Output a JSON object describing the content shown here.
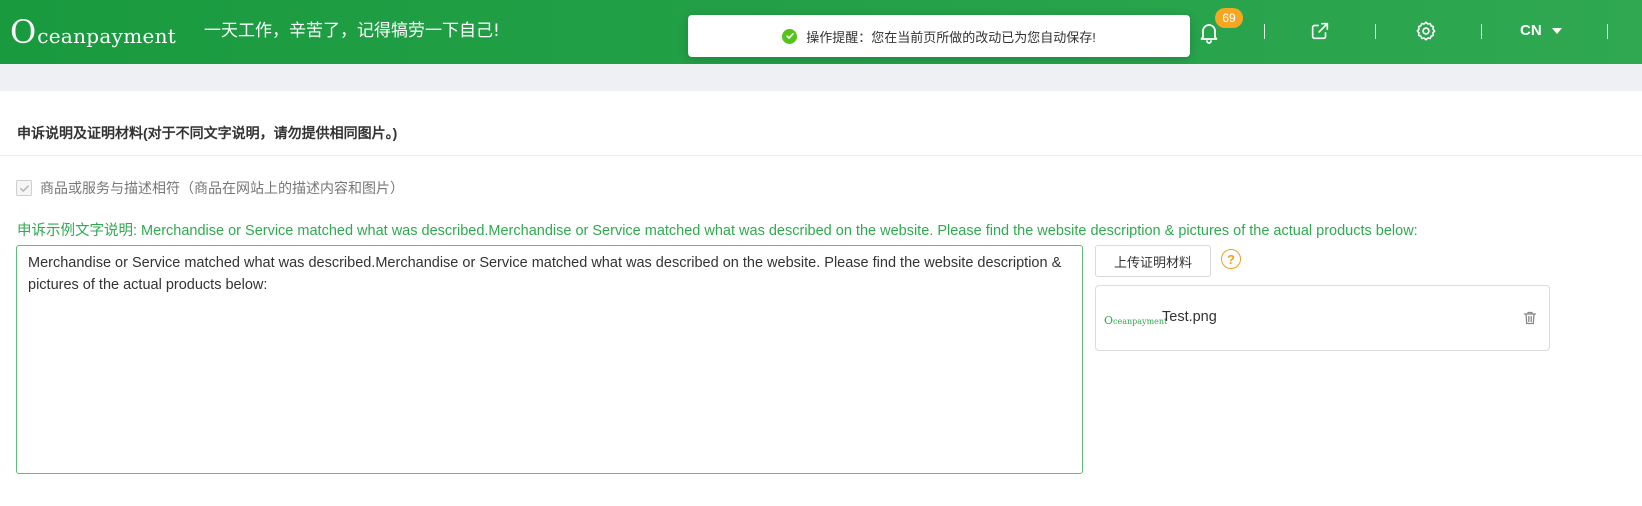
{
  "header": {
    "logo_initial": "O",
    "logo_rest": "ceanpayment",
    "slogan": "一天工作，辛苦了，记得犒劳一下自己!",
    "notification_count": "69",
    "language": "CN",
    "icons": [
      "bell-icon",
      "external-link-icon",
      "gear-icon",
      "chevron-down-icon"
    ],
    "accent_color": "#1a9a3f"
  },
  "toast": {
    "message": "操作提醒：您在当前页所做的改动已为您自动保存!",
    "icon": "check-circle-icon",
    "status_color": "#52c41a"
  },
  "form": {
    "section_title": "申诉说明及证明材料(对于不同文字说明，请勿提供相同图片。)",
    "checkbox_label": "商品或服务与描述相符（商品在网站上的描述内容和图片）",
    "checkbox_checked": true,
    "example_text": "申诉示例文字说明: Merchandise or Service matched what was described.Merchandise or Service matched what was described on the website. Please find the website description & pictures of the actual products below:",
    "textarea_value": "Merchandise or Service matched what was described.Merchandise or Service matched what was described on the website. Please find the website description & pictures of the actual products below:",
    "upload_button": "上传证明材料",
    "help_icon_text": "?",
    "files": [
      {
        "thumb_initial": "O",
        "thumb_rest": "ceanpayment",
        "name": "Test.png"
      }
    ]
  }
}
